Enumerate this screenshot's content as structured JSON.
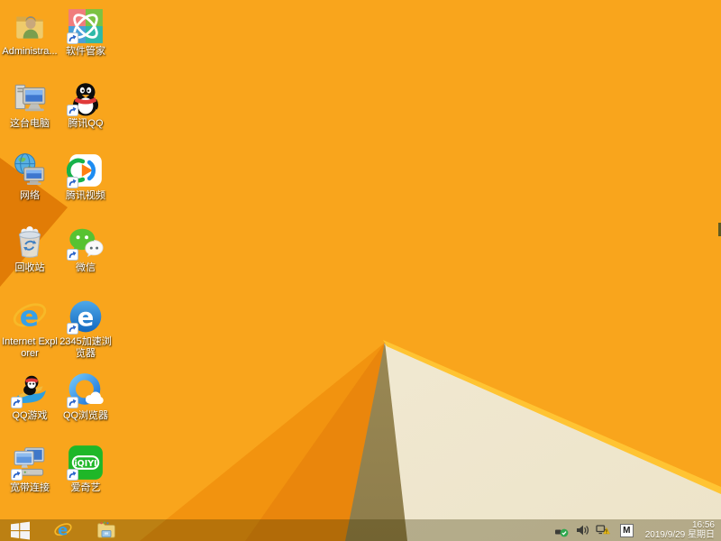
{
  "colors": {
    "wallpaper-base": "#F9A51C",
    "wallpaper-shade1": "#F2930F",
    "wallpaper-shade2": "#EA860C",
    "wallpaper-wedge": "#E17C06",
    "wallpaper-olive-top": "#AE9B63",
    "wallpaper-olive-bottom": "#8E7D4B",
    "wallpaper-cream": "#F5EEDC",
    "wallpaper-cream-deep": "#EDE4C9",
    "wallpaper-gold": "#FFC433",
    "taskbar-tint": "rgba(60,50,0,0.32)",
    "icon-label": "#FFFFFF",
    "tray-text": "#FFFFFF"
  },
  "desktop": {
    "icons": [
      {
        "name": "administrator",
        "label": "Administra..."
      },
      {
        "name": "software-manager",
        "label": "软件管家"
      },
      {
        "name": "this-pc",
        "label": "这台电脑"
      },
      {
        "name": "tencent-qq",
        "label": "腾讯QQ"
      },
      {
        "name": "network",
        "label": "网络"
      },
      {
        "name": "tencent-video",
        "label": "腾讯视频"
      },
      {
        "name": "recycle-bin",
        "label": "回收站"
      },
      {
        "name": "wechat",
        "label": "微信"
      },
      {
        "name": "internet-explorer",
        "label": "Internet Explorer"
      },
      {
        "name": "2345-browser",
        "label": "2345加速浏览器"
      },
      {
        "name": "qq-games",
        "label": "QQ游戏"
      },
      {
        "name": "qq-browser",
        "label": "QQ浏览器"
      },
      {
        "name": "broadband",
        "label": "宽带连接"
      },
      {
        "name": "iqiyi",
        "label": "爱奇艺",
        "logo_text": "iQIYI"
      }
    ]
  },
  "taskbar": {
    "tray": {
      "input_indicator": "M",
      "time": "16:56",
      "date": "2019/9/29 星期日"
    }
  }
}
